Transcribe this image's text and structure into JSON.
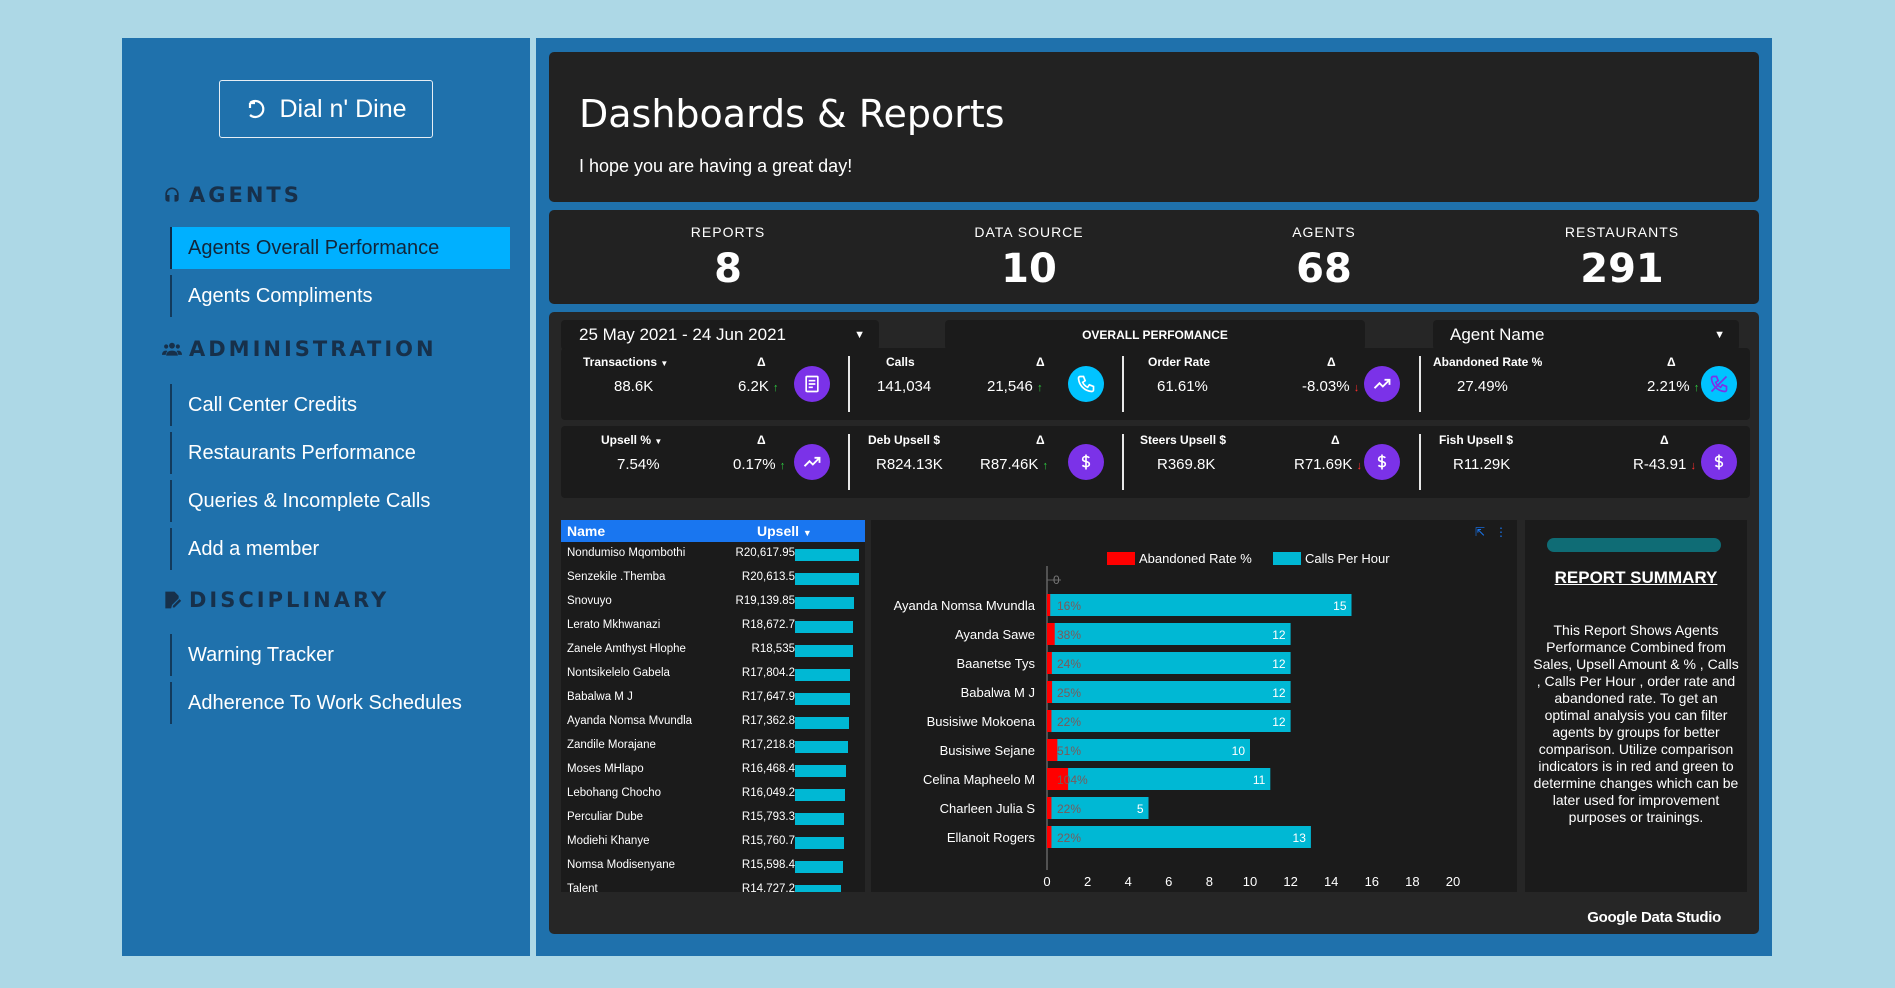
{
  "sidebar": {
    "brand": "Dial n' Dine",
    "sections": [
      {
        "title": "AGENTS",
        "icon": "headset-icon",
        "items": [
          "Agents Overall Performance",
          "Agents Compliments"
        ]
      },
      {
        "title": "ADMINISTRATION",
        "icon": "users-icon",
        "items": [
          "Call Center Credits",
          "Restaurants Performance",
          "Queries & Incomplete Calls",
          "Add a member"
        ]
      },
      {
        "title": "DISCIPLINARY",
        "icon": "edit-doc-icon",
        "items": [
          "Warning Tracker",
          "Adherence To Work Schedules"
        ]
      }
    ],
    "active_item": "Agents Overall Performance"
  },
  "header": {
    "title": "Dashboards & Reports",
    "subtitle": "I hope you are having a great day!"
  },
  "stats": [
    {
      "label": "REPORTS",
      "value": "8"
    },
    {
      "label": "DATA SOURCE",
      "value": "10"
    },
    {
      "label": "AGENTS",
      "value": "68"
    },
    {
      "label": "RESTAURANTS",
      "value": "291"
    }
  ],
  "filters": {
    "date_range": "25 May 2021 - 24 Jun 2021",
    "section_label": "OVERALL PERFOMANCE",
    "agent_dropdown": "Agent Name"
  },
  "kpis": {
    "row1": [
      {
        "label": "Transactions",
        "sortable": true,
        "value": "88.6K",
        "delta_label": "Δ",
        "delta": "6.2K",
        "direction": "up",
        "icon": "receipt-icon",
        "icon_color": "#7b32e8"
      },
      {
        "label": "Calls",
        "sortable": false,
        "value": "141,034",
        "delta_label": "Δ",
        "delta": "21,546",
        "direction": "up",
        "icon": "phone-icon",
        "icon_color": "#00c3ff"
      },
      {
        "label": "Order Rate",
        "sortable": false,
        "value": "61.61%",
        "delta_label": "Δ",
        "delta": "-8.03%",
        "direction": "down",
        "icon": "trending-up-icon",
        "icon_color": "#7b32e8"
      },
      {
        "label": "Abandoned Rate %",
        "sortable": false,
        "value": "27.49%",
        "delta_label": "Δ",
        "delta": "2.21%",
        "direction": "up",
        "icon": "no-phone-icon",
        "icon_color": "#00c3ff"
      }
    ],
    "row2": [
      {
        "label": "Upsell %",
        "sortable": true,
        "value": "7.54%",
        "delta_label": "Δ",
        "delta": "0.17%",
        "direction": "up",
        "icon": "trending-up-icon",
        "icon_color": "#7b32e8"
      },
      {
        "label": "Deb Upsell $",
        "sortable": false,
        "value": "R824.13K",
        "delta_label": "Δ",
        "delta": "R87.46K",
        "direction": "up",
        "icon": "dollar-icon",
        "icon_color": "#7b32e8"
      },
      {
        "label": "Steers Upsell $",
        "sortable": false,
        "value": "R369.8K",
        "delta_label": "Δ",
        "delta": "R71.69K",
        "direction": "down",
        "icon": "dollar-icon",
        "icon_color": "#7b32e8"
      },
      {
        "label": "Fish Upsell $",
        "sortable": false,
        "value": "R11.29K",
        "delta_label": "Δ",
        "delta": "R-43.91",
        "direction": "down",
        "icon": "dollar-icon",
        "icon_color": "#7b32e8"
      }
    ]
  },
  "upsell_table": {
    "columns": [
      "Name",
      "Upsell"
    ],
    "max_value": 20617.95,
    "rows": [
      {
        "name": "Nondumiso Mqombothi",
        "upsell": "R20,617.95",
        "value": 20617.95
      },
      {
        "name": "Senzekile .Themba",
        "upsell": "R20,613.5",
        "value": 20613.5
      },
      {
        "name": "Snovuyo",
        "upsell": "R19,139.85",
        "value": 19139.85
      },
      {
        "name": "Lerato Mkhwanazi",
        "upsell": "R18,672.7",
        "value": 18672.7
      },
      {
        "name": "Zanele Amthyst Hlophe",
        "upsell": "R18,535",
        "value": 18535
      },
      {
        "name": "Nontsikelelo Gabela",
        "upsell": "R17,804.2",
        "value": 17804.2
      },
      {
        "name": "Babalwa M J",
        "upsell": "R17,647.9",
        "value": 17647.9
      },
      {
        "name": "Ayanda Nomsa Mvundla",
        "upsell": "R17,362.8",
        "value": 17362.8
      },
      {
        "name": "Zandile Morajane",
        "upsell": "R17,218.8",
        "value": 17218.8
      },
      {
        "name": "Moses MHlapo",
        "upsell": "R16,468.4",
        "value": 16468.4
      },
      {
        "name": "Lebohang Chocho",
        "upsell": "R16,049.2",
        "value": 16049.2
      },
      {
        "name": "Perculiar Dube",
        "upsell": "R15,793.3",
        "value": 15793.3
      },
      {
        "name": "Modiehi Khanye",
        "upsell": "R15,760.7",
        "value": 15760.7
      },
      {
        "name": "Nomsa Modisenyane",
        "upsell": "R15,598.4",
        "value": 15598.4
      },
      {
        "name": "Talent",
        "upsell": "R14,727.2",
        "value": 14727.2
      }
    ]
  },
  "chart_data": {
    "type": "bar",
    "orientation": "horizontal",
    "categories": [
      "Ayanda Nomsa Mvundla",
      "Ayanda Sawe",
      "Baanetse Tys",
      "Babalwa M J",
      "Busisiwe Mokoena",
      "Busisiwe Sejane",
      "Celina Mapheelo M",
      "Charleen Julia S",
      "Ellanoit Rogers"
    ],
    "series": [
      {
        "name": "Abandoned Rate %",
        "color": "#ff0000",
        "values": [
          0.16,
          0.38,
          0.24,
          0.25,
          0.22,
          0.51,
          1.04,
          0.22,
          0.22
        ],
        "labels": [
          "16%",
          "38%",
          "24%",
          "25%",
          "22%",
          "51%",
          "104%",
          "22%",
          "22%"
        ]
      },
      {
        "name": "Calls Per Hour",
        "color": "#00b8d4",
        "values": [
          15,
          12,
          12,
          12,
          12,
          10,
          11,
          5,
          13
        ]
      }
    ],
    "x_ticks": [
      0,
      2,
      4,
      6,
      8,
      10,
      12,
      14,
      16,
      18,
      20
    ],
    "xlim": [
      0,
      20
    ],
    "top_tick": "0",
    "legend_position": "top"
  },
  "summary": {
    "title": "REPORT SUMMARY",
    "text": "This Report Shows  Agents Performance Combined from Sales, Upsell Amount & % , Calls , Calls Per Hour , order rate and abandoned rate. To get an optimal analysis you can filter agents by groups for better comparison. Utilize comparison indicators is in red and green to determine changes which can be later used for improvement purposes or trainings."
  },
  "footer": {
    "brand": "Google Data Studio"
  }
}
